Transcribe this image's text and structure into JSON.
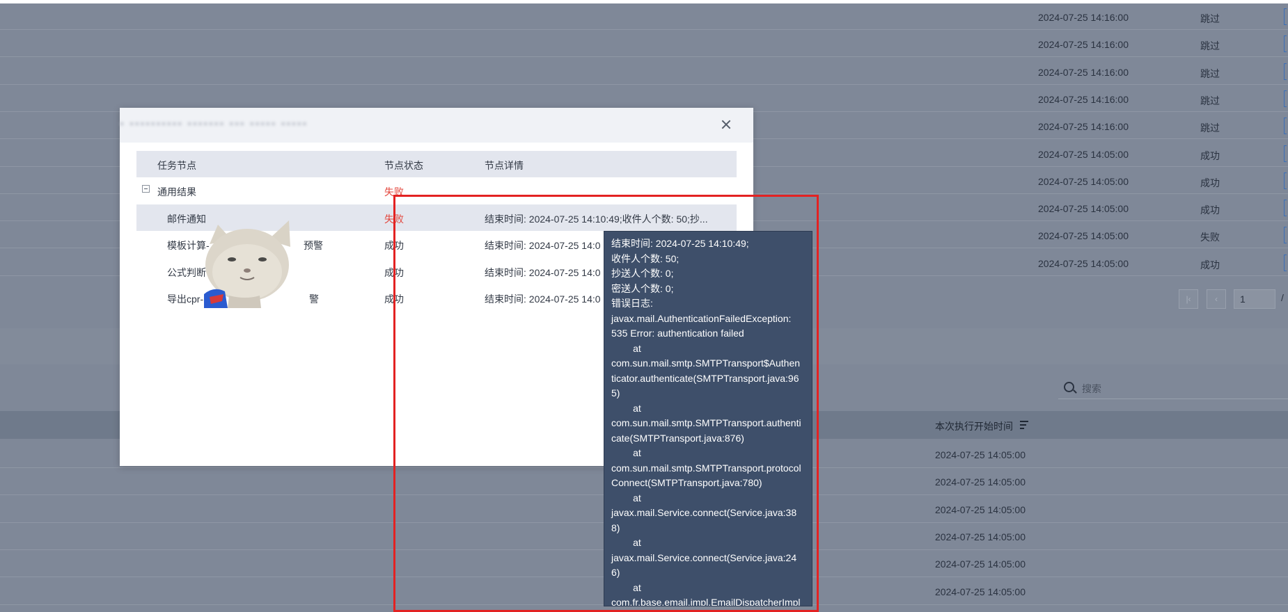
{
  "background": {
    "upper_rows": [
      {
        "time": "2024-07-25 14:16:00",
        "status": "跳过"
      },
      {
        "time": "2024-07-25 14:16:00",
        "status": "跳过"
      },
      {
        "time": "2024-07-25 14:16:00",
        "status": "跳过"
      },
      {
        "time": "2024-07-25 14:16:00",
        "status": "跳过"
      },
      {
        "time": "2024-07-25 14:16:00",
        "status": "跳过"
      },
      {
        "time": "2024-07-25 14:05:00",
        "status": "成功"
      },
      {
        "time": "2024-07-25 14:05:00",
        "status": "成功"
      },
      {
        "time": "2024-07-25 14:05:00",
        "status": "成功"
      },
      {
        "time": "2024-07-25 14:05:00",
        "status": "失败"
      },
      {
        "time": "2024-07-25 14:05:00",
        "status": "成功"
      }
    ],
    "pagination": {
      "first": "|‹",
      "prev": "‹",
      "page": "1",
      "total": "/"
    },
    "search": {
      "placeholder": "搜索"
    },
    "lower_table": {
      "header": "本次执行开始时间",
      "rows": [
        "2024-07-25 14:05:00",
        "2024-07-25 14:05:00",
        "2024-07-25 14:05:00",
        "2024-07-25 14:05:00",
        "2024-07-25 14:05:00",
        "2024-07-25 14:05:00"
      ]
    }
  },
  "modal": {
    "title": "▪ ▪▪▪▪▪▪▪▪▪▪ ▪▪▪▪▪▪▪ ▪▪▪ ▪▪▪▪▪ ▪▪▪▪▪",
    "columns": {
      "node": "任务节点",
      "status": "节点状态",
      "detail": "节点详情"
    },
    "rows": [
      {
        "node": "通用结果",
        "status": "失败",
        "detail": ""
      },
      {
        "node": "邮件通知",
        "status": "失败",
        "detail": "结束时间: 2024-07-25 14:10:49;收件人个数: 50;抄..."
      },
      {
        "node": "模板计算-",
        "node_suffix": "预警",
        "status": "成功",
        "detail": "结束时间: 2024-07-25 14:0"
      },
      {
        "node": "公式判断",
        "status": "成功",
        "detail": "结束时间: 2024-07-25 14:0"
      },
      {
        "node": "导出cpr-",
        "node_suffix": "警",
        "status": "成功",
        "detail": "结束时间: 2024-07-25 14:0"
      }
    ]
  },
  "tooltip": {
    "lines": [
      "结束时间: 2024-07-25 14:10:49;",
      "收件人个数: 50;",
      "抄送人个数: 0;",
      "密送人个数: 0;",
      "错误日志:",
      "javax.mail.AuthenticationFailedException:",
      "535 Error: authentication failed",
      "        at",
      "com.sun.mail.smtp.SMTPTransport$Authen",
      "ticator.authenticate(SMTPTransport.java:96",
      "5)",
      "        at",
      "com.sun.mail.smtp.SMTPTransport.authenti",
      "cate(SMTPTransport.java:876)",
      "        at",
      "com.sun.mail.smtp.SMTPTransport.protocol",
      "Connect(SMTPTransport.java:780)",
      "        at",
      "javax.mail.Service.connect(Service.java:38",
      "8)",
      "        at",
      "javax.mail.Service.connect(Service.java:24",
      "6)",
      "        at",
      "com.fr.base.email.impl.EmailDispatcherImpl"
    ]
  },
  "colors": {
    "fail": "#e3463c",
    "annotation": "#e32222",
    "tooltip_bg": "#3e4f6a"
  }
}
